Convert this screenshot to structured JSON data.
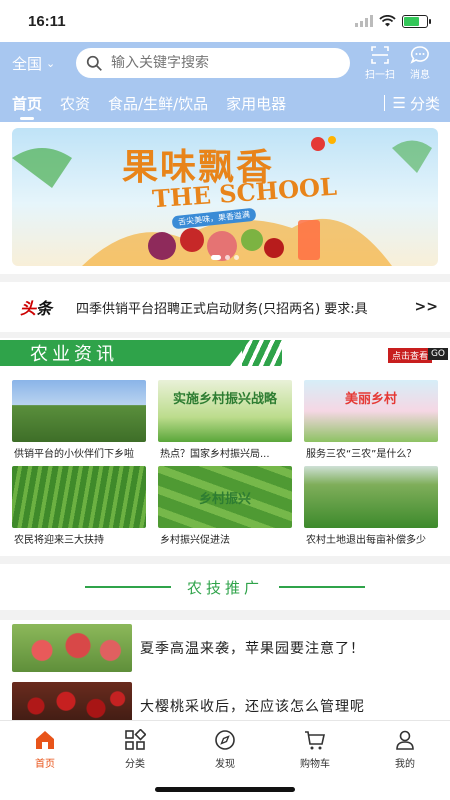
{
  "status": {
    "time": "16:11"
  },
  "header": {
    "region": "全国",
    "search_placeholder": "输入关键字搜索",
    "scan_label": "扫一扫",
    "message_label": "消息"
  },
  "categories": [
    "首页",
    "农资",
    "食品/生鲜/饮品",
    "家用电器"
  ],
  "category_more": "分类",
  "banner": {
    "title_cn": "果味飘香",
    "title_en": "THE SCHOOL",
    "subtitle": "舌尖美味，果香溢满"
  },
  "ticker": {
    "logo_a": "头",
    "logo_b": "条",
    "text": "四季供销平台招聘正式启动财务(只招两名) 要求:具",
    "arrow": ">>"
  },
  "agri_news": {
    "title": "农业资讯",
    "more_label": "点击查看",
    "go_label": "GO",
    "cards": [
      {
        "caption": "供销平台的小伙伴们下乡啦",
        "overlay": ""
      },
      {
        "caption": "热点？国家乡村振兴局...",
        "overlay": "实施乡村振兴战略"
      },
      {
        "caption": "服务三农“三农”是什么？",
        "overlay": "美丽乡村"
      },
      {
        "caption": "农民将迎来三大扶持",
        "overlay": ""
      },
      {
        "caption": "乡村振兴促进法",
        "overlay": "乡村振兴"
      },
      {
        "caption": "农村土地退出每亩补偿多少",
        "overlay": ""
      }
    ]
  },
  "tech_promo": {
    "title": "农技推广",
    "articles": [
      {
        "title": "夏季高温来袭，苹果园要注意了！"
      },
      {
        "title": "大樱桃采收后，还应该怎么管理呢"
      }
    ]
  },
  "tabbar": [
    {
      "label": "首页",
      "icon": "home-icon",
      "active": true
    },
    {
      "label": "分类",
      "icon": "category-icon",
      "active": false
    },
    {
      "label": "发现",
      "icon": "compass-icon",
      "active": false
    },
    {
      "label": "购物车",
      "icon": "cart-icon",
      "active": false
    },
    {
      "label": "我的",
      "icon": "profile-icon",
      "active": false
    }
  ],
  "colors": {
    "header": "#a8c7f0",
    "accent_green": "#2fa34a",
    "active_tab": "#e8541a"
  }
}
